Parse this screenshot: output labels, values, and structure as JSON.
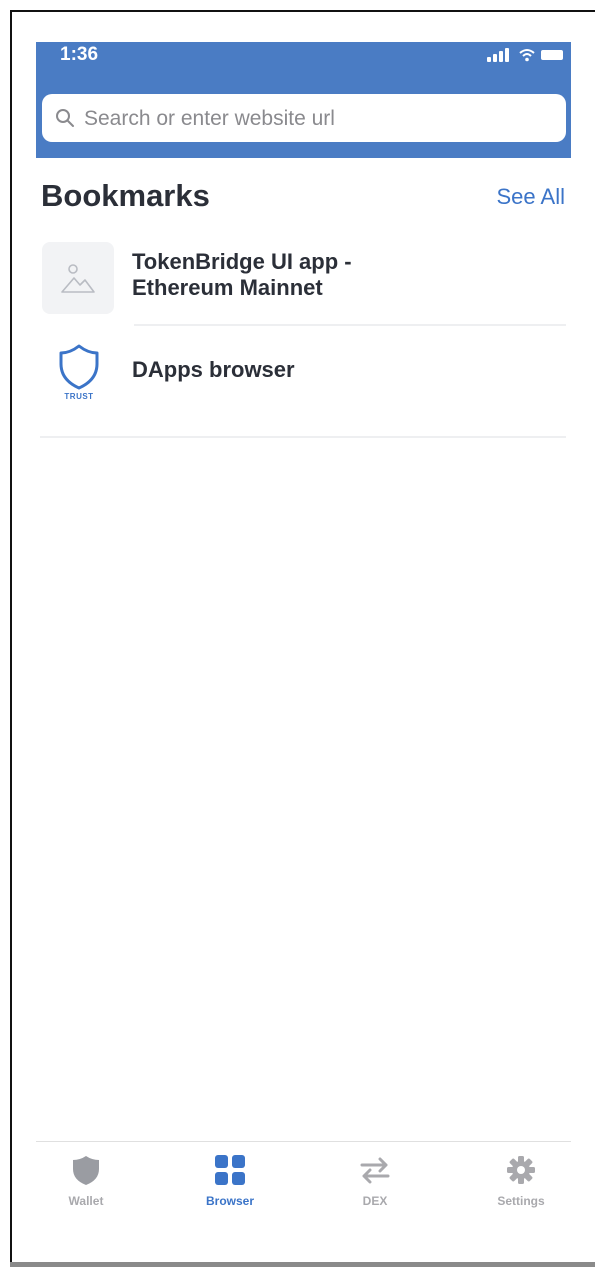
{
  "status_bar": {
    "time": "1:36"
  },
  "search": {
    "placeholder": "Search or enter website url"
  },
  "bookmarks": {
    "title": "Bookmarks",
    "see_all": "See All",
    "items": [
      {
        "label": "TokenBridge UI app - Ethereum Mainnet",
        "icon": "image-placeholder-icon"
      },
      {
        "label": "DApps browser",
        "icon": "trust-shield-icon",
        "logo_text": "TRUST"
      }
    ]
  },
  "tabbar": {
    "active": "Browser",
    "tabs": [
      {
        "label": "Wallet",
        "icon": "shield-icon"
      },
      {
        "label": "Browser",
        "icon": "grid-icon"
      },
      {
        "label": "DEX",
        "icon": "swap-arrows-icon"
      },
      {
        "label": "Settings",
        "icon": "gear-icon"
      }
    ]
  },
  "colors": {
    "header_blue": "#4a7cc4",
    "accent_blue": "#3b74c8",
    "inactive_gray": "#a9a9ad",
    "text_dark": "#2b2f38"
  }
}
